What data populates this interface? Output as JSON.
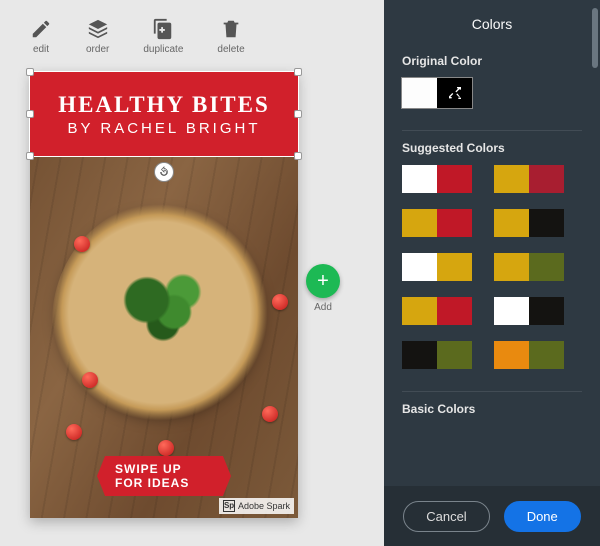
{
  "toolbar": {
    "edit": {
      "label": "edit"
    },
    "order": {
      "label": "order"
    },
    "duplicate": {
      "label": "duplicate"
    },
    "delete": {
      "label": "delete"
    }
  },
  "add": {
    "label": "Add"
  },
  "design": {
    "title": "HEALTHY BITES",
    "byline": "BY RACHEL BRIGHT",
    "cta": "SWIPE UP FOR IDEAS",
    "watermark_badge": "Sp",
    "watermark_text": "Adobe Spark",
    "banner_bg": "#d1202b"
  },
  "panel": {
    "title": "Colors",
    "original_label": "Original Color",
    "suggested_label": "Suggested Colors",
    "basic_label": "Basic Colors",
    "suggested": [
      {
        "a": "#ffffff",
        "b": "#c01827"
      },
      {
        "a": "#d6a60f",
        "b": "#a81e30"
      },
      {
        "a": "#d6a60f",
        "b": "#c01827"
      },
      {
        "a": "#d6a60f",
        "b": "#141311"
      },
      {
        "a": "#ffffff",
        "b": "#d6a60f"
      },
      {
        "a": "#d6a60f",
        "b": "#5b6a1e"
      },
      {
        "a": "#d6a60f",
        "b": "#c01827"
      },
      {
        "a": "#ffffff",
        "b": "#141311"
      },
      {
        "a": "#141311",
        "b": "#5b6a1e"
      },
      {
        "a": "#e98a0f",
        "b": "#5b6a1e"
      }
    ],
    "cancel": "Cancel",
    "done": "Done"
  }
}
